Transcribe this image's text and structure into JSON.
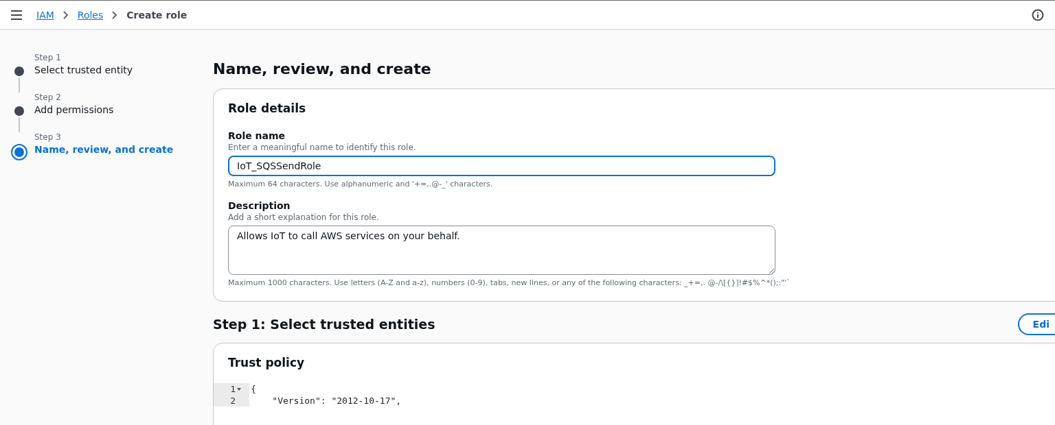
{
  "breadcrumb": [
    {
      "label": "IAM",
      "link": true
    },
    {
      "label": "Roles",
      "link": true
    },
    {
      "label": "Create role",
      "link": false
    }
  ],
  "steps": [
    {
      "step": "Step 1",
      "label": "Select trusted entity",
      "selected": false
    },
    {
      "step": "Step 2",
      "label": "Add permissions",
      "selected": false
    },
    {
      "step": "Step 3",
      "label": "Name, review, and create",
      "selected": true
    }
  ],
  "page_title": "Name, review, and create",
  "role_details": {
    "title": "Role details",
    "fields": [
      {
        "kind": "input",
        "label": "Role name",
        "hint": "Enter a meaningful name to identify this role.",
        "value": "IoT_SQSSendRole",
        "focused": true,
        "constraint": "Maximum 64 characters. Use alphanumeric and '+=,.@-_' characters."
      },
      {
        "kind": "textarea",
        "label": "Description",
        "hint": "Add a short explanation for this role.",
        "value": "Allows IoT to call AWS services on your behalf.",
        "focused": false,
        "constraint": "Maximum 1000 characters. Use letters (A-Z and a-z), numbers (0-9), tabs, new lines, or any of the following characters: _+=,. @-/\\[{}]!#$%^*();:\"'`"
      }
    ]
  },
  "step1": {
    "title": "Step 1: Select trusted entities",
    "edit_button": "Edi",
    "card_title": "Trust policy",
    "code_lines": [
      {
        "number": "1",
        "text": "{",
        "foldable": true
      },
      {
        "number": "2",
        "text": "    \"Version\": \"2012-10-17\",",
        "foldable": false
      }
    ]
  }
}
